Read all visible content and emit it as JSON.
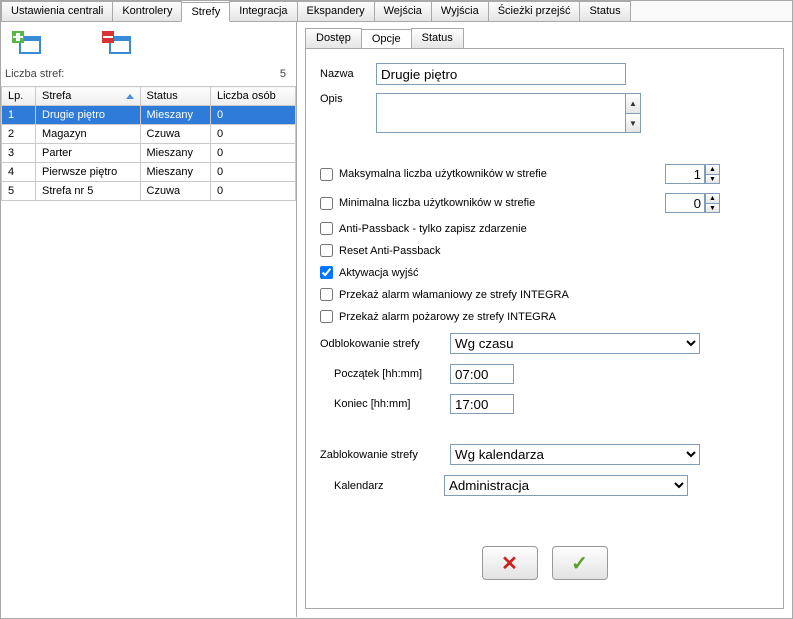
{
  "main_tabs": [
    "Ustawienia centrali",
    "Kontrolery",
    "Strefy",
    "Integracja",
    "Ekspandery",
    "Wejścia",
    "Wyjścia",
    "Ścieżki przejść",
    "Status"
  ],
  "main_tab_active": 2,
  "left": {
    "count_label": "Liczba stref:",
    "count_value": "5",
    "columns": [
      "Lp.",
      "Strefa",
      "Status",
      "Liczba osób"
    ],
    "sorted_col": 1,
    "rows": [
      {
        "lp": "1",
        "strefa": "Drugie piętro",
        "status": "Mieszany",
        "osob": "0",
        "selected": true
      },
      {
        "lp": "2",
        "strefa": "Magazyn",
        "status": "Czuwa",
        "osob": "0"
      },
      {
        "lp": "3",
        "strefa": "Parter",
        "status": "Mieszany",
        "osob": "0"
      },
      {
        "lp": "4",
        "strefa": "Pierwsze piętro",
        "status": "Mieszany",
        "osob": "0"
      },
      {
        "lp": "5",
        "strefa": "Strefa nr 5",
        "status": "Czuwa",
        "osob": "0"
      }
    ]
  },
  "sub_tabs": [
    "Dostęp",
    "Opcje",
    "Status"
  ],
  "sub_tab_active": 1,
  "f": {
    "nazwa_lbl": "Nazwa",
    "nazwa_val": "Drugie piętro",
    "opis_lbl": "Opis",
    "opis_val": "",
    "max_users_lbl": "Maksymalna liczba użytkowników w strefie",
    "max_users_val": "1",
    "min_users_lbl": "Minimalna liczba użytkowników w strefie",
    "min_users_val": "0",
    "apb_log_lbl": "Anti-Passback - tylko zapisz zdarzenie",
    "apb_reset_lbl": "Reset Anti-Passback",
    "aktywacja_lbl": "Aktywacja wyjść",
    "alarm_wlam_lbl": "Przekaż alarm włamaniowy ze strefy INTEGRA",
    "alarm_poz_lbl": "Przekaż alarm pożarowy ze strefy INTEGRA",
    "odblok_lbl": "Odblokowanie strefy",
    "odblok_val": "Wg czasu",
    "poczatek_lbl": "Początek [hh:mm]",
    "poczatek_val": "07:00",
    "koniec_lbl": "Koniec [hh:mm]",
    "koniec_val": "17:00",
    "zablok_lbl": "Zablokowanie strefy",
    "zablok_val": "Wg kalendarza",
    "kalendarz_lbl": "Kalendarz",
    "kalendarz_val": "Administracja",
    "checked": {
      "aktywacja": true,
      "max": false,
      "min": false,
      "apb_log": false,
      "apb_reset": false,
      "alarm_wlam": false,
      "alarm_poz": false
    }
  }
}
